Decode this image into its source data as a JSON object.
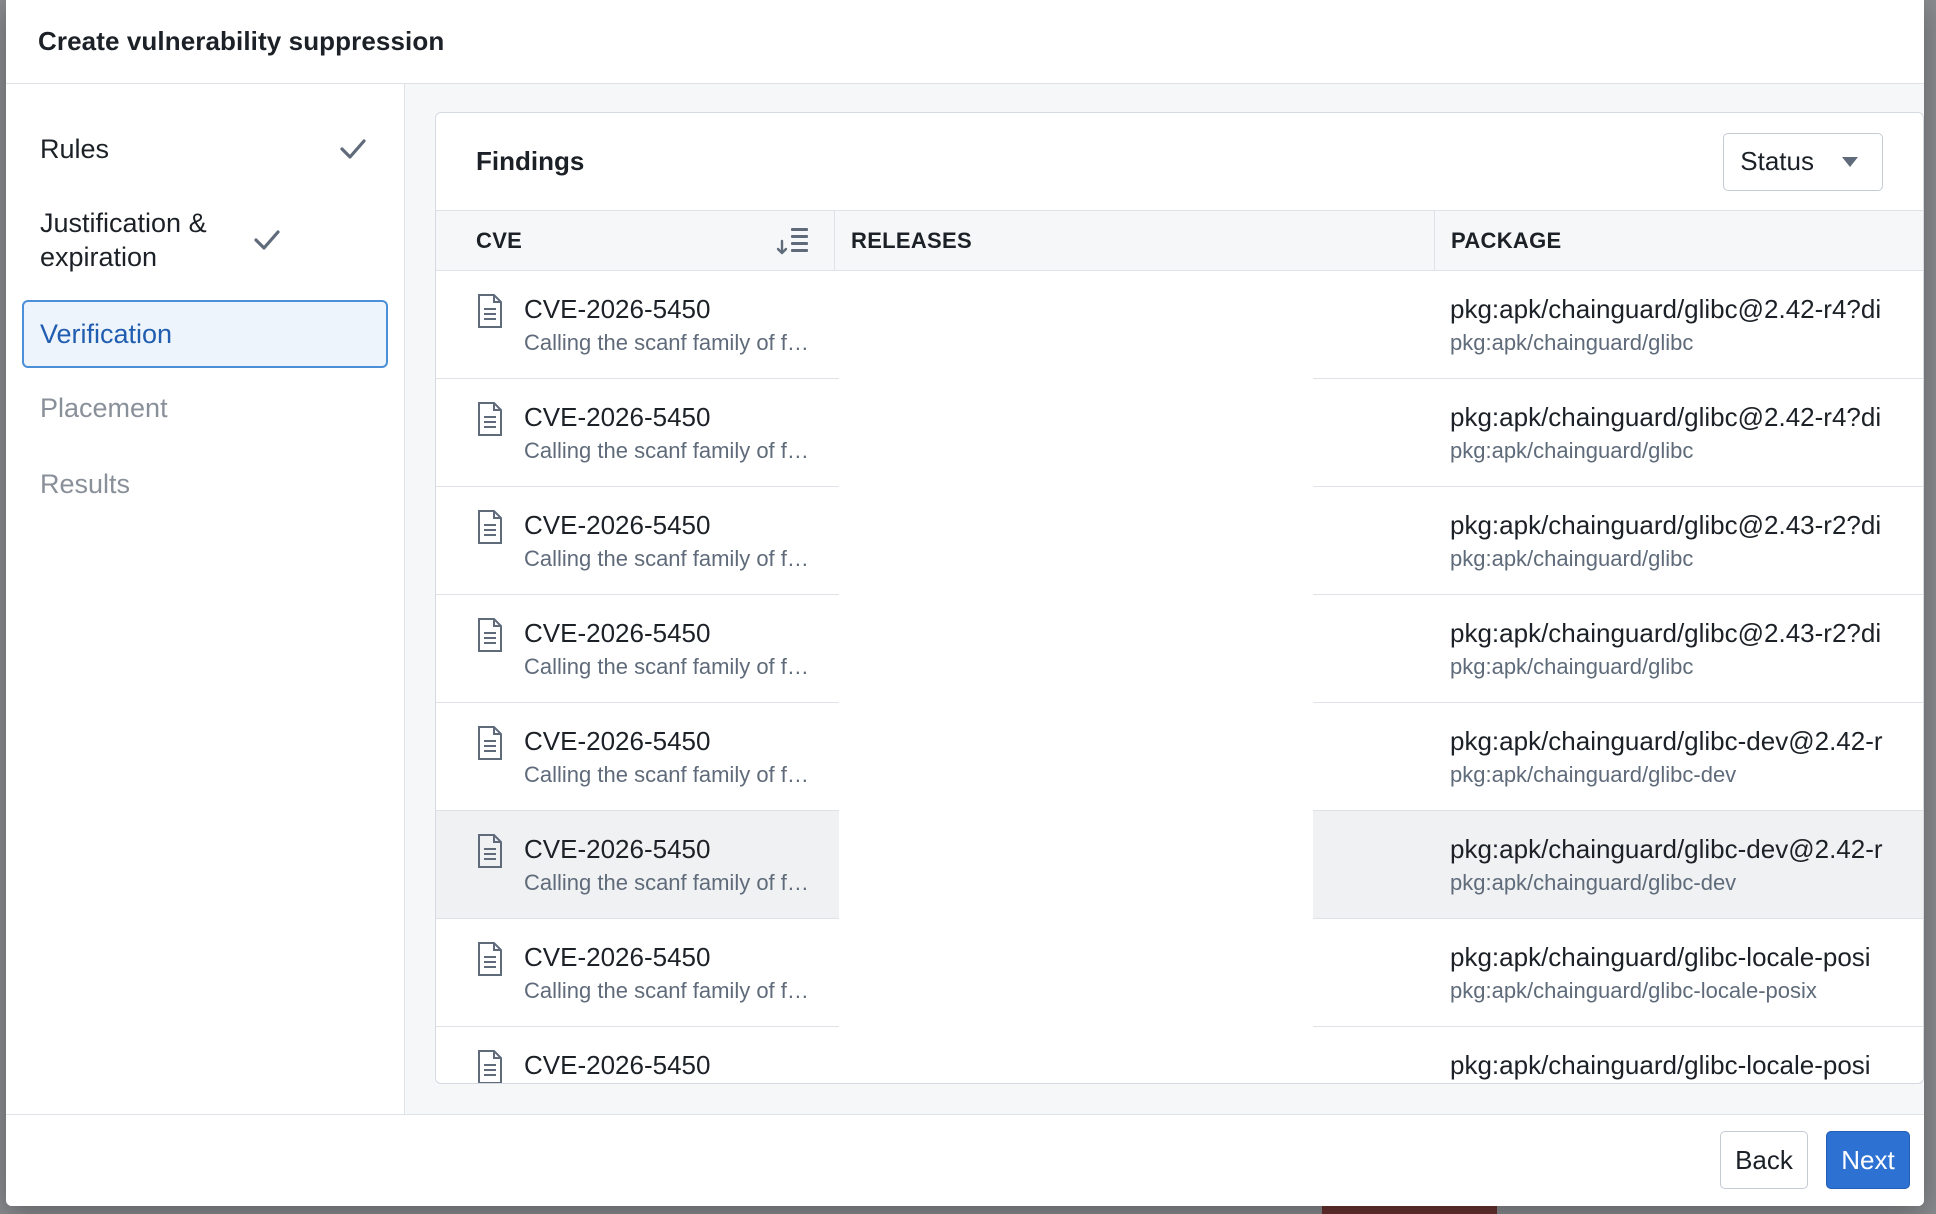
{
  "modal": {
    "title": "Create vulnerability suppression"
  },
  "sidebar": {
    "steps": [
      {
        "label": "Rules",
        "state": "complete"
      },
      {
        "label": "Justification & expiration",
        "state": "complete"
      },
      {
        "label": "Verification",
        "state": "active"
      },
      {
        "label": "Placement",
        "state": "pending"
      },
      {
        "label": "Results",
        "state": "pending"
      }
    ]
  },
  "findings": {
    "title": "Findings",
    "status_button": "Status",
    "columns": [
      "CVE",
      "RELEASES",
      "PACKAGE"
    ],
    "rows": [
      {
        "cve": "CVE-2026-5450",
        "desc": "Calling the scanf family of f…",
        "pkg": "pkg:apk/chainguard/glibc@2.42-r4?di",
        "pkg_sub": "pkg:apk/chainguard/glibc"
      },
      {
        "cve": "CVE-2026-5450",
        "desc": "Calling the scanf family of f…",
        "pkg": "pkg:apk/chainguard/glibc@2.42-r4?di",
        "pkg_sub": "pkg:apk/chainguard/glibc"
      },
      {
        "cve": "CVE-2026-5450",
        "desc": "Calling the scanf family of f…",
        "pkg": "pkg:apk/chainguard/glibc@2.43-r2?di",
        "pkg_sub": "pkg:apk/chainguard/glibc"
      },
      {
        "cve": "CVE-2026-5450",
        "desc": "Calling the scanf family of f…",
        "pkg": "pkg:apk/chainguard/glibc@2.43-r2?di",
        "pkg_sub": "pkg:apk/chainguard/glibc"
      },
      {
        "cve": "CVE-2026-5450",
        "desc": "Calling the scanf family of f…",
        "pkg": "pkg:apk/chainguard/glibc-dev@2.42-r",
        "pkg_sub": "pkg:apk/chainguard/glibc-dev"
      },
      {
        "cve": "CVE-2026-5450",
        "desc": "Calling the scanf family of f…",
        "pkg": "pkg:apk/chainguard/glibc-dev@2.42-r",
        "pkg_sub": "pkg:apk/chainguard/glibc-dev"
      },
      {
        "cve": "CVE-2026-5450",
        "desc": "Calling the scanf family of f…",
        "pkg": "pkg:apk/chainguard/glibc-locale-posi",
        "pkg_sub": "pkg:apk/chainguard/glibc-locale-posix"
      },
      {
        "cve": "CVE-2026-5450",
        "desc": "",
        "pkg": "pkg:apk/chainguard/glibc-locale-posi",
        "pkg_sub": ""
      }
    ]
  },
  "footer": {
    "back": "Back",
    "next": "Next"
  },
  "colors": {
    "primary": "#2d72d2",
    "active_step_bg": "#edf4fc",
    "active_step_border": "#4a8fd8",
    "row_highlight": "#f0f1f3"
  }
}
